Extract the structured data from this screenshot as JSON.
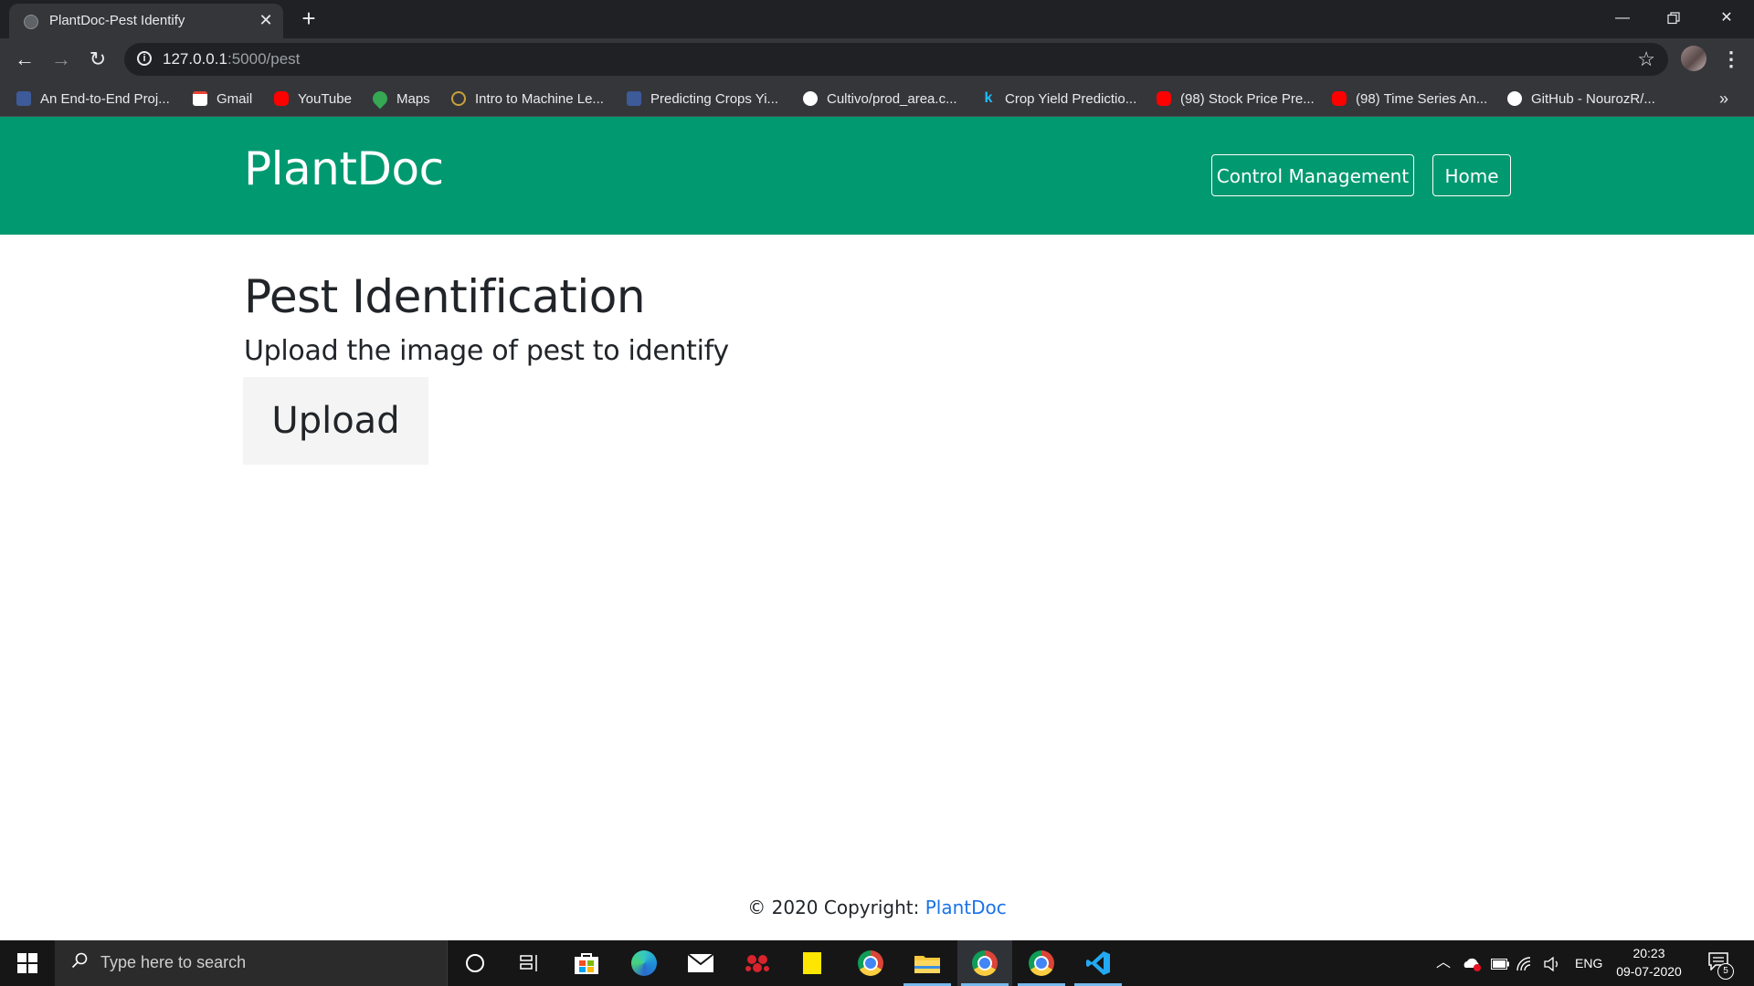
{
  "browser": {
    "tab_title": "PlantDoc-Pest Identify",
    "url_host": "127.0.0.1",
    "url_path": ":5000/pest",
    "bookmarks": [
      {
        "label": "An End-to-End Proj...",
        "icon": "tds-icon"
      },
      {
        "label": "Gmail",
        "icon": "gmail-icon"
      },
      {
        "label": "YouTube",
        "icon": "youtube-icon"
      },
      {
        "label": "Maps",
        "icon": "maps-icon"
      },
      {
        "label": "Intro to Machine Le...",
        "icon": "kaggle-learn-icon"
      },
      {
        "label": "Predicting Crops Yi...",
        "icon": "tds-icon"
      },
      {
        "label": "Cultivo/prod_area.c...",
        "icon": "github-icon"
      },
      {
        "label": "Crop Yield Predictio...",
        "icon": "kaggle-icon"
      },
      {
        "label": "(98) Stock Price Pre...",
        "icon": "youtube-icon"
      },
      {
        "label": "(98) Time Series An...",
        "icon": "youtube-icon"
      },
      {
        "label": "GitHub - NourozR/...",
        "icon": "github-icon"
      }
    ],
    "bookmarks_more": "»"
  },
  "site": {
    "brand": "PlantDoc",
    "nav": [
      {
        "label": "Control Management"
      },
      {
        "label": "Home"
      }
    ],
    "brand_color": "#009970"
  },
  "main": {
    "title": "Pest Identification",
    "subtitle": "Upload the image of pest to identify",
    "upload_label": "Upload"
  },
  "footer": {
    "copyright": "© 2020 Copyright: ",
    "link": "PlantDoc"
  },
  "taskbar": {
    "search_placeholder": "Type here to search",
    "language": "ENG",
    "time": "20:23",
    "date": "09-07-2020",
    "notification_count": "5"
  }
}
